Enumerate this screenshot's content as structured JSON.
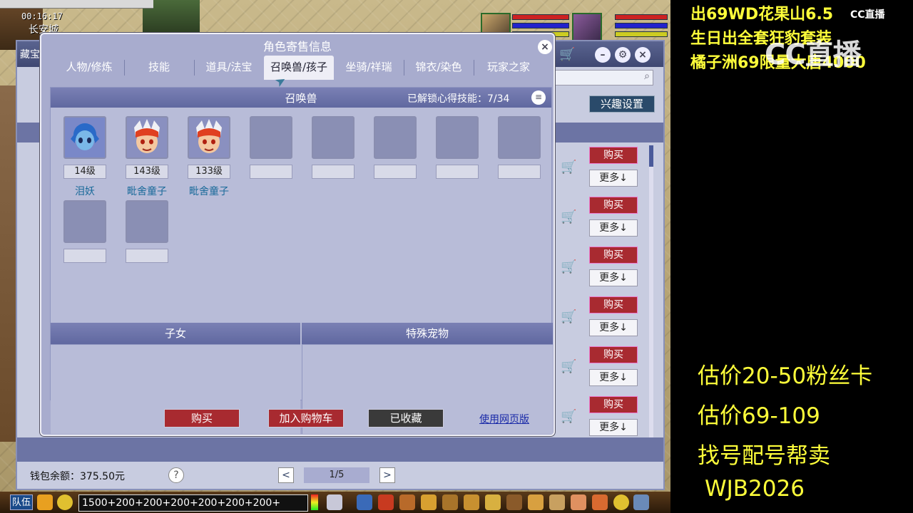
{
  "game": {
    "clock": "00:16:17",
    "city": "长安城"
  },
  "shop": {
    "title": "藏宝",
    "interest_button": "兴趣设置",
    "buy_label": "购买",
    "more_label": "更多↓",
    "wallet": "钱包余额：375.50元",
    "help": "?",
    "page": "1/5",
    "prev": "<",
    "next": ">"
  },
  "dialog": {
    "title": "角色寄售信息",
    "close": "×",
    "tabs": [
      "人物/修炼",
      "技能",
      "道具/法宝",
      "召唤兽/孩子",
      "坐骑/祥瑞",
      "锦衣/染色",
      "玩家之家"
    ],
    "active_tab": 3,
    "panel_title": "召唤兽",
    "unlock_text": "已解锁心得技能：7/34",
    "menu": "≡",
    "pets": [
      {
        "level": "14级",
        "name": "泪妖"
      },
      {
        "level": "143级",
        "name": "毗舍童子"
      },
      {
        "level": "133级",
        "name": "毗舍童子"
      }
    ],
    "children_title": "子女",
    "special_title": "特殊宠物",
    "buttons": {
      "buy": "购买",
      "add_cart": "加入购物车",
      "favorited": "已收藏",
      "web": "使用网页版"
    }
  },
  "taskbar": {
    "team": "队伍",
    "chat_text": "1500+200+200+200+200+200+200+"
  },
  "overlay": {
    "top_lines": [
      "出69WD花果山6.5",
      "生日出全套狂豹套装",
      "橘子洲69限量大唐4000"
    ],
    "bottom_lines": [
      "估价20-50粉丝卡",
      "估价69-109",
      "找号配号帮卖",
      "WJB2026"
    ],
    "logo": "CC直播",
    "watermark": "CC直播"
  },
  "colors": {
    "accent": "#6068a0",
    "buy_red": "#a82a30",
    "overlay_yellow": "#ffff3a"
  }
}
